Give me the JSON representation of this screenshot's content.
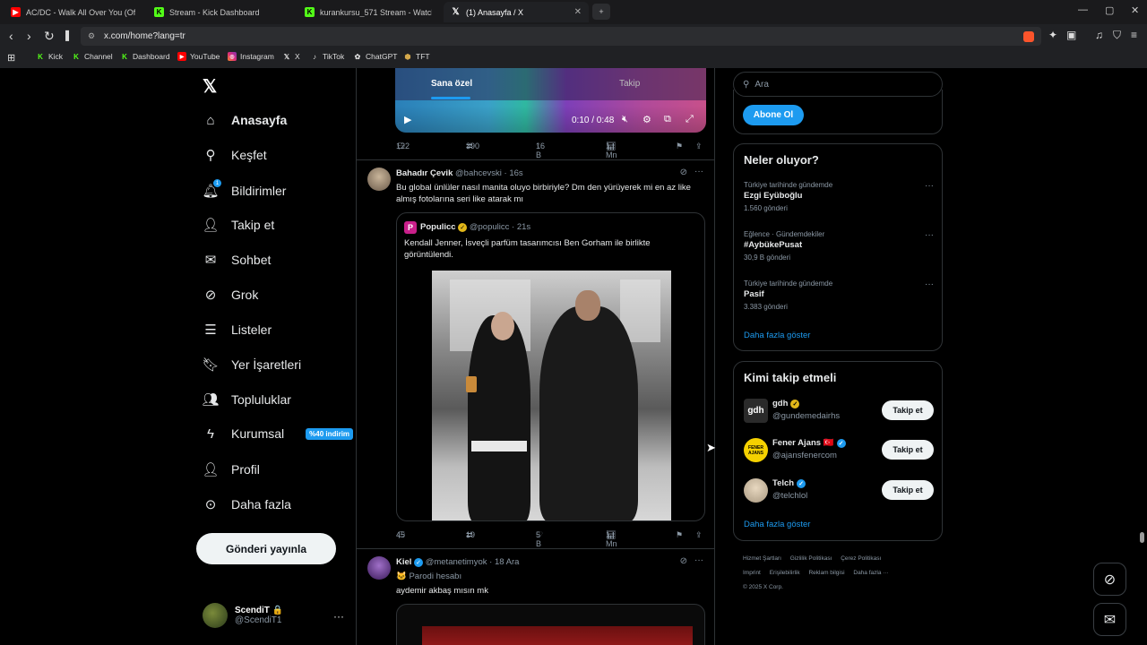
{
  "browser": {
    "tabs": [
      {
        "title": "AC/DC - Walk All Over You (Offic",
        "favicon": "youtube-icon",
        "color": "#ff0000"
      },
      {
        "title": "Stream - Kick Dashboard",
        "favicon": "kick-icon",
        "color": "#53fc18"
      },
      {
        "title": "kurankursu_571 Stream - Watch Live",
        "favicon": "kick-icon",
        "color": "#53fc18"
      },
      {
        "title": "(1) Anasayfa / X",
        "favicon": "x-icon",
        "color": "#ffffff"
      }
    ],
    "new_tab": "+",
    "url": "x.com/home?lang=tr",
    "bookmarks": [
      {
        "label": "Kick",
        "icon": "kick-icon"
      },
      {
        "label": "Channel",
        "icon": "kick-icon"
      },
      {
        "label": "Dashboard",
        "icon": "kick-icon"
      },
      {
        "label": "YouTube",
        "icon": "youtube-icon"
      },
      {
        "label": "Instagram",
        "icon": "instagram-icon"
      },
      {
        "label": "X",
        "icon": "x-icon"
      },
      {
        "label": "TikTok",
        "icon": "tiktok-icon"
      },
      {
        "label": "ChatGPT",
        "icon": "chatgpt-icon"
      },
      {
        "label": "TFT",
        "icon": "tft-icon"
      }
    ]
  },
  "sidebar": {
    "logo": "𝕏",
    "items": [
      {
        "label": "Anasayfa",
        "icon": "home-icon"
      },
      {
        "label": "Keşfet",
        "icon": "search-icon"
      },
      {
        "label": "Bildirimler",
        "icon": "bell-icon",
        "badge": "1"
      },
      {
        "label": "Takip et",
        "icon": "follow-icon"
      },
      {
        "label": "Sohbet",
        "icon": "mail-icon"
      },
      {
        "label": "Grok",
        "icon": "grok-icon"
      },
      {
        "label": "Listeler",
        "icon": "list-icon"
      },
      {
        "label": "Yer İşaretleri",
        "icon": "bookmark-icon"
      },
      {
        "label": "Topluluklar",
        "icon": "communities-icon"
      },
      {
        "label": "Kurumsal",
        "icon": "lightning-icon",
        "promo": "%40 indirim"
      },
      {
        "label": "Profil",
        "icon": "profile-icon"
      },
      {
        "label": "Daha fazla",
        "icon": "more-icon"
      }
    ],
    "post_button": "Gönderi yayınla",
    "account": {
      "name": "ScendiT 🔒",
      "handle": "@ScendiT1",
      "more": "···"
    }
  },
  "feed": {
    "video": {
      "tab_for_you": "Sana özel",
      "tab_following": "Takip",
      "time": "0:10 / 0:48"
    },
    "tweet0_stats": {
      "replies": "122",
      "retweets": "390",
      "likes": "16 B",
      "views": "1 Mn"
    },
    "tweet1": {
      "name": "Bahadır Çevik",
      "handle": "@bahcevski · 16s",
      "text": "Bu global ünlüler nasıl manita oluyo birbiriyle? Dm den yürüyerek mi en az like almış fotolarına seri like atarak mı",
      "quote": {
        "name": "Populicc",
        "handle": "@populicc · 21s",
        "text": "Kendall Jenner, İsveçli parfüm tasarımcısı Ben Gorham ile birlikte görüntülendi."
      },
      "stats": {
        "replies": "45",
        "retweets": "19",
        "likes": "5 B",
        "views": "1 Mn"
      }
    },
    "tweet2": {
      "name": "Kiel",
      "handle": "@metanetimyok · 18 Ara",
      "label": "🐱 Parodi hesabı",
      "text": "aydemir akbaş mısın mk"
    }
  },
  "right": {
    "search_placeholder": "Ara",
    "subscribe": "Abone Ol",
    "trends_title": "Neler oluyor?",
    "trends": [
      {
        "context": "Türkiye tarihinde gündemde",
        "topic": "Ezgi Eyüboğlu",
        "count": "1.560 gönderi"
      },
      {
        "context": "Eğlence · Gündemdekiler",
        "topic": "#AybükePusat",
        "count": "30,9 B gönderi"
      },
      {
        "context": "Türkiye tarihinde gündemde",
        "topic": "Pasif",
        "count": "3.383 gönderi"
      }
    ],
    "trends_more": "Daha fazla göster",
    "who_title": "Kimi takip etmeli",
    "who": [
      {
        "name": "gdh",
        "handle": "@gundemedairhs",
        "badge": "gold",
        "avatar": "gdh"
      },
      {
        "name": "Fener Ajans 🇹🇷",
        "handle": "@ajansfenercom",
        "badge": "blue",
        "avatar": "FENER AJANS"
      },
      {
        "name": "Telch",
        "handle": "@telchlol",
        "badge": "blue",
        "avatar": ""
      }
    ],
    "follow_label": "Takip et",
    "who_more": "Daha fazla göster",
    "footer": [
      "Hizmet Şartları",
      "Gizlilik Politikası",
      "Çerez Politikası",
      "Imprint",
      "Erişilebilirlik",
      "Reklam bilgisi",
      "Daha fazla ···",
      "© 2025 X Corp."
    ]
  }
}
